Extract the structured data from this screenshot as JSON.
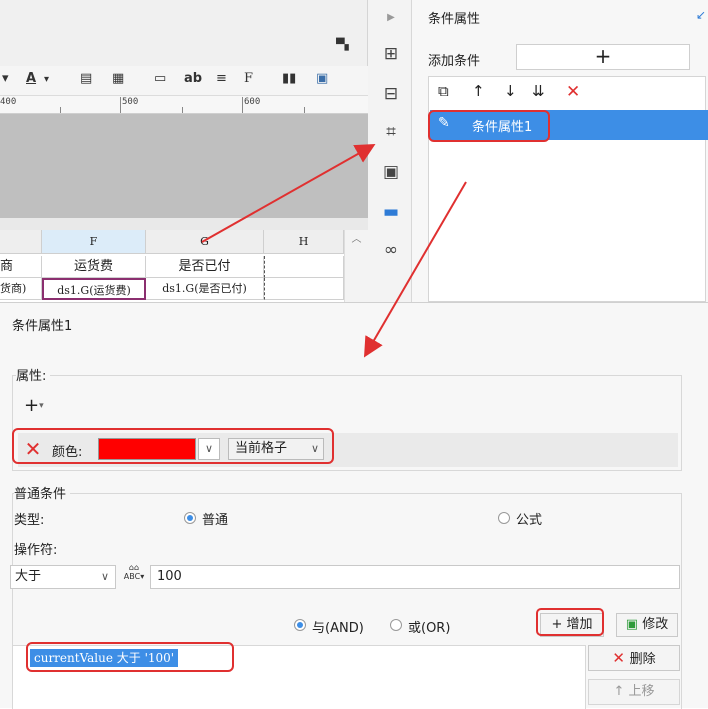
{
  "designer": {
    "toolbar_icons": [
      "underline-A-icon",
      "align-icon",
      "grid-icon",
      "merge-icon",
      "ab-icon",
      "align-text-icon",
      "formula-icon",
      "bar-chart-icon",
      "image-icon"
    ],
    "ruler_labels": [
      "400",
      "500",
      "600"
    ],
    "columns": [
      "F",
      "G",
      "H"
    ],
    "row1": [
      "商",
      "运货费",
      "是否已付"
    ],
    "row2": [
      "货商)",
      "ds1.G(运货费)",
      "ds1.G(是否已付)"
    ]
  },
  "right_panel": {
    "title": "条件属性",
    "add_condition_label": "添加条件",
    "add_condition_button": "+",
    "condition_item": "条件属性1"
  },
  "dialog": {
    "title": "条件属性1",
    "attributes_label": "属性:",
    "add_attribute": "+",
    "color_label": "颜色:",
    "color_value": "#ff0000",
    "scope_value": "当前格子",
    "normal_condition_label": "普通条件",
    "type_label": "类型:",
    "type_normal": "普通",
    "type_formula": "公式",
    "operator_label": "操作符:",
    "operator_value": "大于",
    "value": "100",
    "logic_and": "与(AND)",
    "logic_or": "或(OR)",
    "add_button": "增加",
    "edit_button": "修改",
    "condition_expression": "currentValue 大于 '100'",
    "delete_button": "删除",
    "move_up_button": "上移"
  },
  "colors": {
    "accent": "#3d8ee6",
    "highlight_red": "#e03030",
    "swatch": "#ff0000"
  }
}
